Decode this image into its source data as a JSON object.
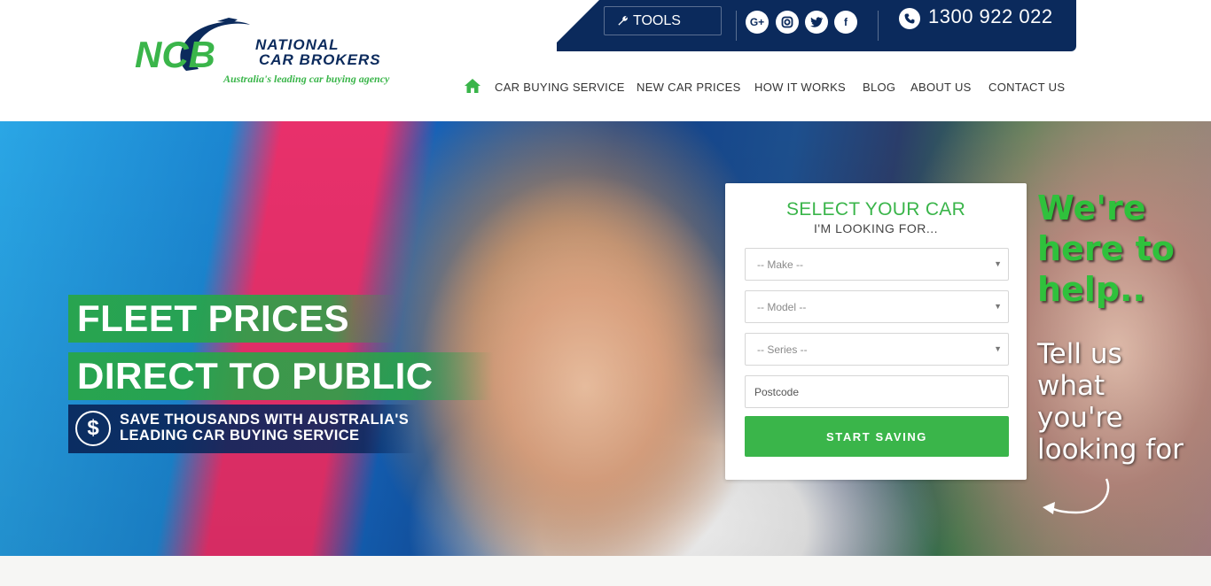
{
  "brand": {
    "logo_letters": "NCB",
    "name_line1": "NATIONAL",
    "name_line2": "CAR BROKERS",
    "tagline": "Australia's leading car buying agency",
    "colors": {
      "navy": "#0b2a5c",
      "green": "#3ab54a"
    }
  },
  "topbar": {
    "tools_label": "TOOLS",
    "social": [
      {
        "icon": "google-plus-icon",
        "glyph": "G+"
      },
      {
        "icon": "instagram-icon",
        "glyph": "◎"
      },
      {
        "icon": "twitter-icon",
        "glyph": "t"
      },
      {
        "icon": "facebook-icon",
        "glyph": "f"
      }
    ],
    "phone": "1300 922 022"
  },
  "nav": {
    "home_icon": "home-icon",
    "items": [
      {
        "label": "CAR BUYING SERVICE"
      },
      {
        "label": "NEW CAR PRICES"
      },
      {
        "label": "HOW IT WORKS"
      },
      {
        "label": "BLOG"
      },
      {
        "label": "ABOUT US"
      },
      {
        "label": "CONTACT US"
      }
    ]
  },
  "hero": {
    "headline_1": "FLEET PRICES",
    "headline_2": "DIRECT TO PUBLIC",
    "subline_1": "SAVE THOUSANDS WITH AUSTRALIA'S",
    "subline_2": "LEADING CAR BUYING SERVICE",
    "dollar_glyph": "$"
  },
  "form": {
    "title": "SELECT YOUR CAR",
    "subtitle": "I'M LOOKING FOR...",
    "make_placeholder": "-- Make --",
    "model_placeholder": "-- Model --",
    "series_placeholder": "-- Series --",
    "postcode_placeholder": "Postcode",
    "postcode_value": "",
    "submit_label": "START SAVING"
  },
  "handwriting": {
    "green_1": "We're",
    "green_2": "here to",
    "green_3": "help..",
    "white_1": "Tell us",
    "white_2": "what",
    "white_3": "you're",
    "white_4": "looking for"
  }
}
